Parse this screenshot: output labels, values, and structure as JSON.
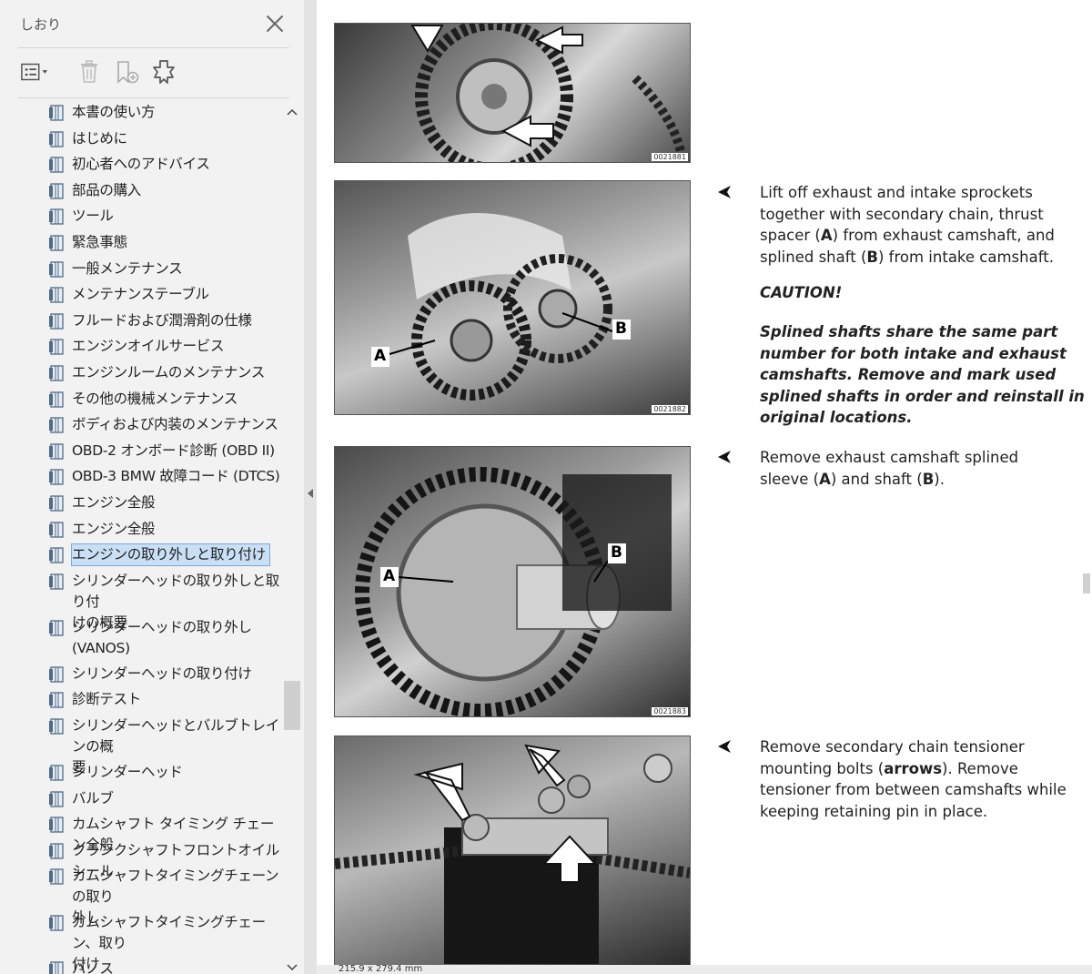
{
  "sidebar": {
    "title": "しおり",
    "tree": [
      {
        "label": "本書の使い方"
      },
      {
        "label": "はじめに"
      },
      {
        "label": "初心者へのアドバイス"
      },
      {
        "label": "部品の購入"
      },
      {
        "label": "ツール"
      },
      {
        "label": "緊急事態"
      },
      {
        "label": "一般メンテナンス"
      },
      {
        "label": "メンテナンステーブル"
      },
      {
        "label": "フルードおよび潤滑剤の仕様"
      },
      {
        "label": "エンジンオイルサービス"
      },
      {
        "label": "エンジンルームのメンテナンス"
      },
      {
        "label": "その他の機械メンテナンス"
      },
      {
        "label": "ボディおよび内装のメンテナンス"
      },
      {
        "label": "OBD-2 オンボード診断 (OBD II)"
      },
      {
        "label": "OBD-3 BMW 故障コード (DTCS)"
      },
      {
        "label": "エンジン全般"
      },
      {
        "label": "エンジン全般"
      },
      {
        "label": "エンジンの取り外しと取り付け",
        "selected": true
      },
      {
        "label": "シリンダーヘッドの取り外しと取り付\nけの概要"
      },
      {
        "label": "シリンダーヘッドの取り外し\n(VANOS)"
      },
      {
        "label": "シリンダーヘッドの取り付け"
      },
      {
        "label": "診断テスト"
      },
      {
        "label": "シリンダーヘッドとバルブトレインの概\n要"
      },
      {
        "label": "シリンダーヘッド"
      },
      {
        "label": "バルブ"
      },
      {
        "label": "カムシャフト タイミング チェーン全般"
      },
      {
        "label": "クランクシャフトフロントオイルシール"
      },
      {
        "label": "カムシャフトタイミングチェーンの取り\n外し"
      },
      {
        "label": "カムシャフトタイミングチェーン、取り\n付け"
      },
      {
        "label": "バノス"
      }
    ]
  },
  "document": {
    "photos": [
      {
        "number": "0021881"
      },
      {
        "number": "0021882",
        "labels": [
          "A",
          "B"
        ]
      },
      {
        "number": "0021883",
        "labels": [
          "A",
          "B"
        ]
      },
      {
        "number": ""
      }
    ],
    "step1": "Lift off exhaust and intake sprockets\ntogether with secondary chain, thrust\nspacer (A) from exhaust camshaft, and\nsplined shaft (B) from intake camshaft.",
    "caution_title": "CAUTION!",
    "caution_body": "Splined shafts share the same part\nnumber for both intake and exhaust\ncamshafts. Remove and mark used\nsplined shafts in order and reinstall in\noriginal locations.",
    "step2": "Remove exhaust camshaft splined\nsleeve (A) and shaft (B).",
    "step3": "Remove secondary chain tensioner\nmounting bolts (arrows). Remove\ntensioner from between camshafts while\nkeeping retaining pin in place."
  },
  "statusbar": {
    "page_size": "215.9 x 279.4 mm"
  }
}
